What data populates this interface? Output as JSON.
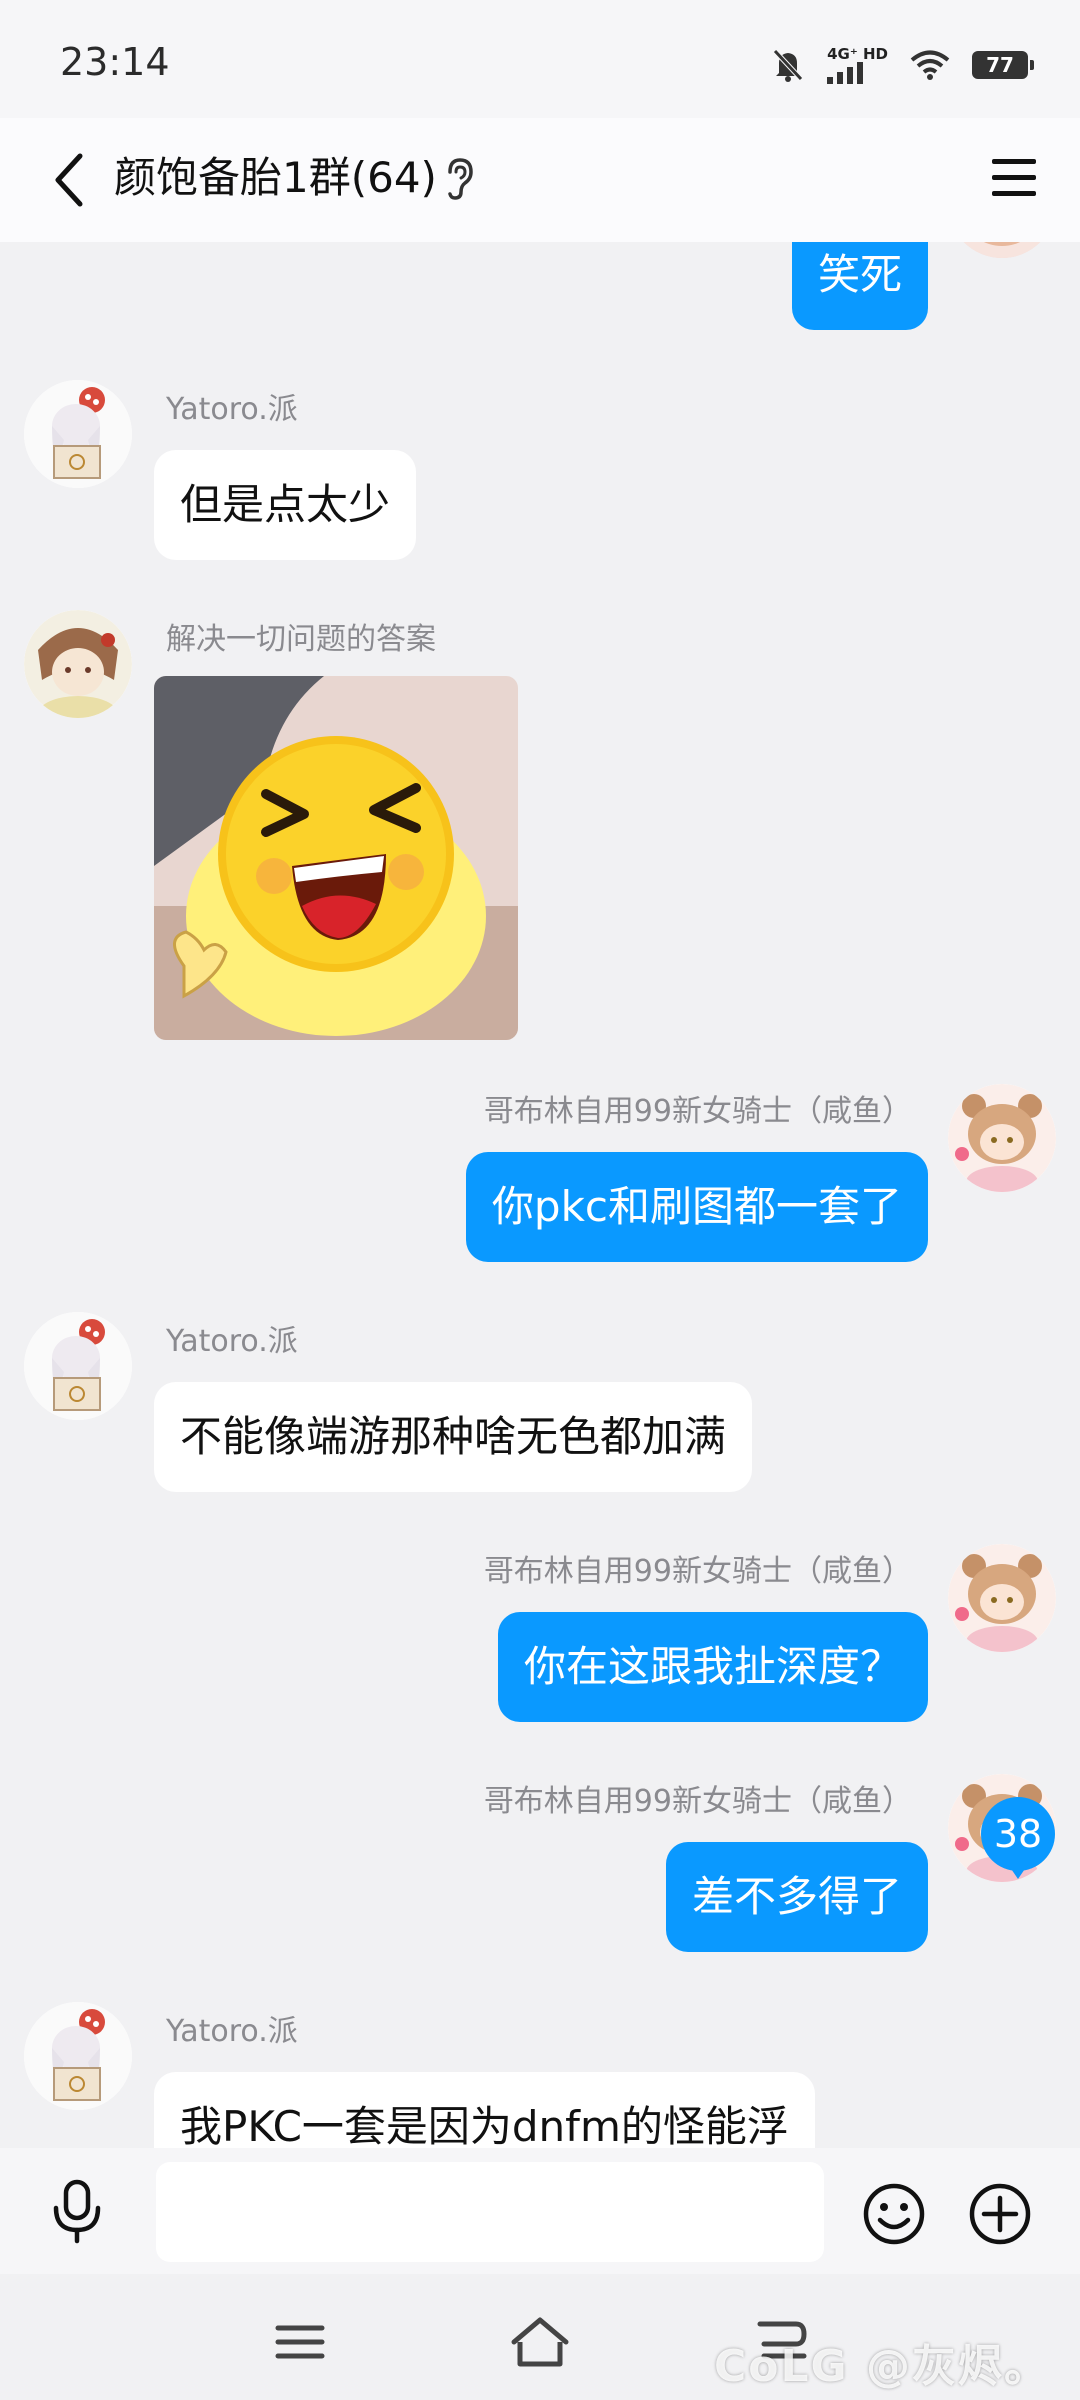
{
  "status_bar": {
    "time": "23:14",
    "network": "4G⁺ HD",
    "battery": "77"
  },
  "header": {
    "title": "颜饱备胎1群(64)"
  },
  "messages": [
    {
      "side": "out",
      "text": "笑死"
    },
    {
      "side": "in",
      "sender": "Yatoro.派",
      "text": "但是点太少"
    },
    {
      "side": "in",
      "sender": "解决一切问题的答案",
      "type": "sticker",
      "sticker": "laughing-emoji-sticker"
    },
    {
      "side": "out",
      "sender": "哥布林自用99新女骑士（咸鱼）",
      "text": "你pkc和刷图都一套了"
    },
    {
      "side": "in",
      "sender": "Yatoro.派",
      "text": "不能像端游那种啥无色都加满"
    },
    {
      "side": "out",
      "sender": "哥布林自用99新女骑士（咸鱼）",
      "text": "你在这跟我扯深度？"
    },
    {
      "side": "out",
      "sender": "哥布林自用99新女骑士（咸鱼）",
      "text": "差不多得了"
    },
    {
      "side": "in",
      "sender": "Yatoro.派",
      "text": "我PKC一套是因为dnfm的怪能浮"
    }
  ],
  "unread_count": "38",
  "input": {
    "placeholder": ""
  },
  "watermark": "CoLG @灰烬。",
  "colors": {
    "accent": "#0a99ff",
    "background": "#f1f1f3",
    "incoming_bubble": "#ffffff"
  },
  "icons": {
    "back": "chevron-left-icon",
    "ear": "ear-icon",
    "menu": "hamburger-menu-icon",
    "mic": "microphone-icon",
    "emoji": "smiley-icon",
    "plus": "plus-circle-icon"
  }
}
